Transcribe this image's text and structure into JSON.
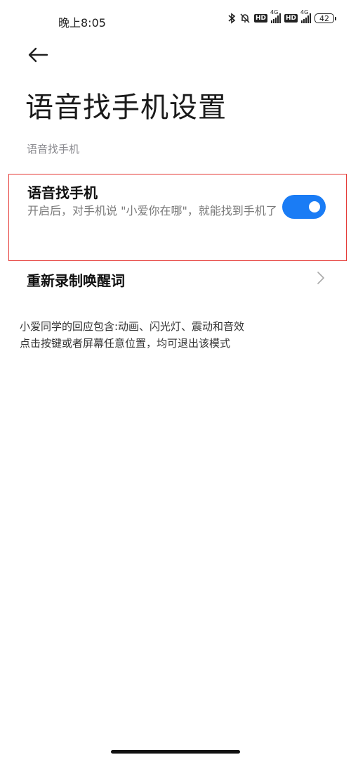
{
  "status_bar": {
    "time": "晚上8:05",
    "hd_label": "HD",
    "network_label": "4G",
    "battery": "42",
    "icons": [
      "bluetooth-icon",
      "mute-bell-icon",
      "hd-icon",
      "signal-icon",
      "hd-icon",
      "signal-icon",
      "battery-icon"
    ]
  },
  "header": {
    "back_icon": "back-arrow-icon",
    "title": "语音找手机设置"
  },
  "section": {
    "header": "语音找手机"
  },
  "voice_find_phone": {
    "title": "语音找手机",
    "description": "开启后，对手机说 \"小爱你在哪\"，就能找到手机了",
    "enabled": true,
    "toggle_color": "#1a7cf5"
  },
  "rerecord": {
    "label": "重新录制唤醒词",
    "chevron_icon": "chevron-right-icon"
  },
  "info": {
    "line1": "小爱同学的回应包含:动画、闪光灯、震动和音效",
    "line2": "点击按键或者屏幕任意位置，均可退出该模式"
  },
  "colors": {
    "accent": "#1a7cf5",
    "highlight_border": "#e53935"
  }
}
